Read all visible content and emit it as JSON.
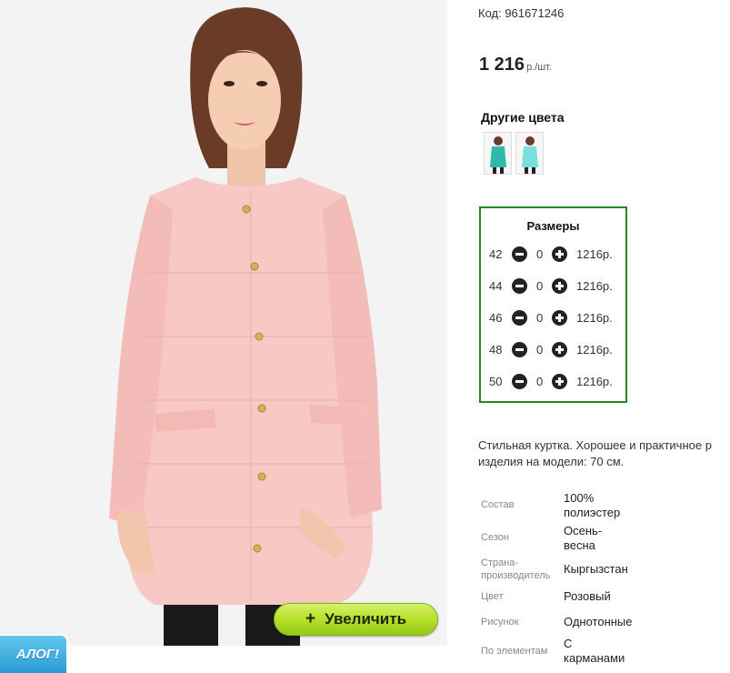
{
  "product": {
    "code": "Код: 961671246",
    "price_amount": "1 216",
    "price_unit": "р./шт."
  },
  "colors": {
    "title": "Другие цвета",
    "swatches": [
      {
        "color": "#2fb9a8"
      },
      {
        "color": "#78e0da"
      }
    ]
  },
  "sizes": {
    "title": "Размеры",
    "rows": [
      {
        "size": "42",
        "qty": "0",
        "price": "1216р."
      },
      {
        "size": "44",
        "qty": "0",
        "price": "1216р."
      },
      {
        "size": "46",
        "qty": "0",
        "price": "1216р."
      },
      {
        "size": "48",
        "qty": "0",
        "price": "1216р."
      },
      {
        "size": "50",
        "qty": "0",
        "price": "1216р."
      }
    ]
  },
  "description": {
    "line1": "Стильная куртка. Хорошее и практичное р",
    "line2": "изделия на модели: 70 см."
  },
  "attributes": {
    "composition": {
      "label": "Состав",
      "value": "100% полиэстер"
    },
    "season": {
      "label": "Сезон",
      "value": "Осень-весна"
    },
    "country": {
      "label": "Страна-производитель",
      "value": "Кыргызстан"
    },
    "color": {
      "label": "Цвет",
      "value": "Розовый"
    },
    "pattern": {
      "label": "Рисунок",
      "value": "Однотонные"
    },
    "details": {
      "label": "По элементам",
      "value": "С карманами"
    }
  },
  "photo": {
    "zoom_plus": "+",
    "zoom_label": "Увеличить"
  },
  "catalog_badge": "АЛОГ!",
  "theme": {
    "jacket": "#f7c8c4",
    "sizes_border": "#1f8a1f",
    "zoom_button": "#b5e02c",
    "catalog_badge": "#2a9bd6"
  }
}
